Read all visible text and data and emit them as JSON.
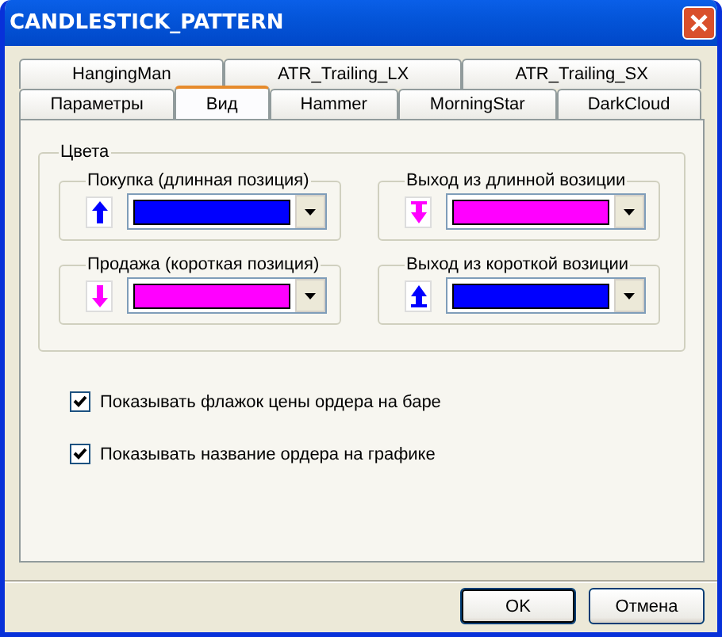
{
  "window": {
    "title": "CANDLESTICK_PATTERN"
  },
  "tab_rows": [
    [
      {
        "label": "HangingMan",
        "selected": false
      },
      {
        "label": "ATR_Trailing_LX",
        "selected": false
      },
      {
        "label": "ATR_Trailing_SX",
        "selected": false
      }
    ],
    [
      {
        "label": "Параметры",
        "selected": false
      },
      {
        "label": "Вид",
        "selected": true
      },
      {
        "label": "Hammer",
        "selected": false
      },
      {
        "label": "MorningStar",
        "selected": false
      },
      {
        "label": "DarkCloud",
        "selected": false
      }
    ]
  ],
  "colors_group": {
    "title": "Цвета",
    "items": [
      {
        "label": "Покупка (длинная позиция)",
        "kind": "up",
        "color": "#0000ff"
      },
      {
        "label": "Выход из длинной возиции",
        "kind": "exit-down",
        "color": "#ff00ff"
      },
      {
        "label": "Продажа (короткая позиция)",
        "kind": "down",
        "color": "#ff00ff"
      },
      {
        "label": "Выход из короткой возиции",
        "kind": "exit-up",
        "color": "#0000ff"
      }
    ]
  },
  "checkboxes": [
    {
      "label": "Показывать флажок цены ордера на баре",
      "checked": true
    },
    {
      "label": "Показывать название ордера на графике",
      "checked": true
    }
  ],
  "buttons": [
    {
      "label": "OK",
      "default": true
    },
    {
      "label": "Отмена",
      "default": false
    }
  ]
}
